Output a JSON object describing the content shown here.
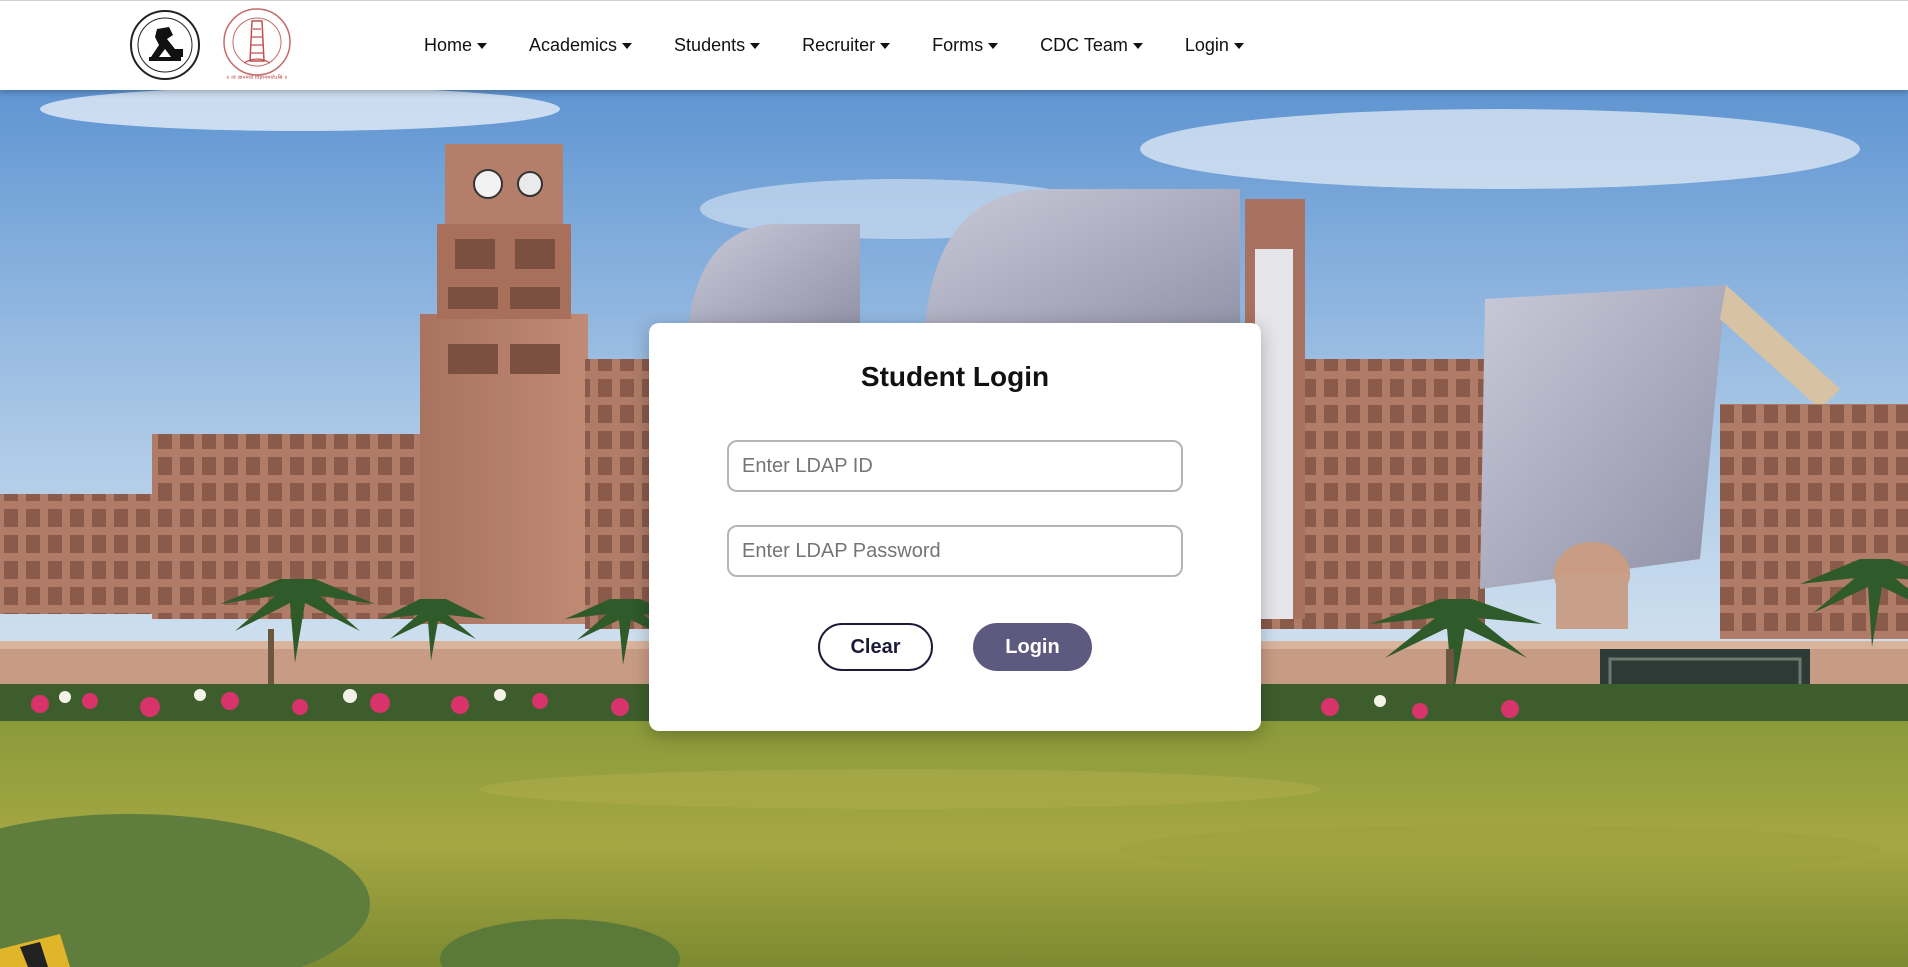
{
  "nav": {
    "items": [
      {
        "label": "Home"
      },
      {
        "label": "Academics"
      },
      {
        "label": "Students"
      },
      {
        "label": "Recruiter"
      },
      {
        "label": "Forms"
      },
      {
        "label": "CDC Team"
      },
      {
        "label": "Login"
      }
    ],
    "logo_caption": "॥ त्वं ज्ञानमयो विज्ञानमयोऽसि ॥"
  },
  "login": {
    "title": "Student Login",
    "ldap_id_placeholder": "Enter LDAP ID",
    "ldap_password_placeholder": "Enter LDAP Password",
    "clear_label": "Clear",
    "login_label": "Login"
  },
  "colors": {
    "login_button": "#5e5a7f",
    "clear_border": "#1c1c3a",
    "navbar_bg": "#ffffff"
  }
}
